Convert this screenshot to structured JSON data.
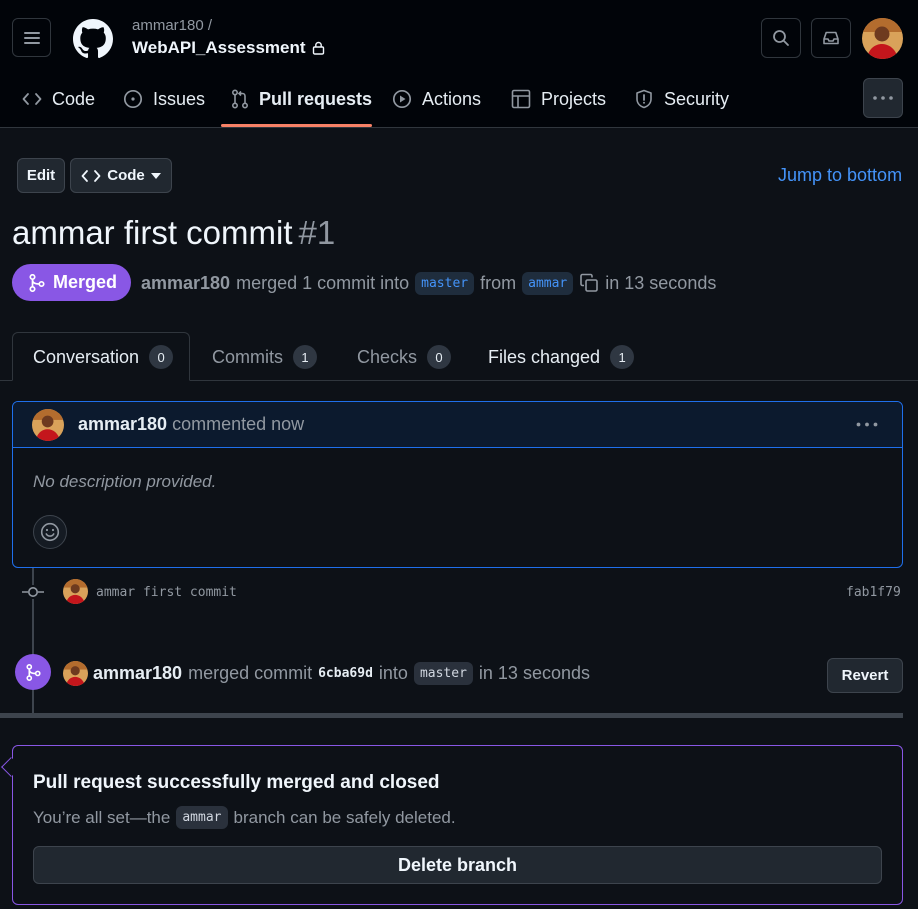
{
  "header": {
    "owner": "ammar180 /",
    "repo": "WebAPI_Assessment"
  },
  "nav": {
    "code": "Code",
    "issues": "Issues",
    "pull_requests": "Pull requests",
    "actions": "Actions",
    "projects": "Projects",
    "security": "Security"
  },
  "toolbar": {
    "edit": "Edit",
    "code": "Code",
    "jump": "Jump to bottom"
  },
  "pr": {
    "title": "ammar first commit",
    "number": "#1",
    "state": "Merged",
    "author": "ammar180",
    "merged_text": "merged 1 commit into",
    "base_branch": "master",
    "from_text": "from",
    "head_branch": "ammar",
    "time_text": "in 13 seconds"
  },
  "tabs": {
    "conversation": "Conversation",
    "conversation_count": "0",
    "commits": "Commits",
    "commits_count": "1",
    "checks": "Checks",
    "checks_count": "0",
    "files": "Files changed",
    "files_count": "1"
  },
  "comment": {
    "author": "ammar180",
    "action": "commented now",
    "body": "No description provided."
  },
  "commit": {
    "message": "ammar first commit",
    "sha": "fab1f79"
  },
  "merge_event": {
    "user": "ammar180",
    "text": "merged commit",
    "sha": "6cba69d",
    "into": "into",
    "branch": "master",
    "time": "in 13 seconds",
    "revert": "Revert"
  },
  "merged_box": {
    "heading": "Pull request successfully merged and closed",
    "before": "You’re all set—the",
    "branch": "ammar",
    "after": "branch can be safely deleted.",
    "delete_label": "Delete branch"
  },
  "colors": {
    "merged": "#8957e5",
    "link": "#4493f8",
    "underline": "#f78166"
  },
  "icons": [
    "hamburger-icon",
    "github-logo-icon",
    "lock-icon",
    "search-icon",
    "inbox-icon",
    "code-icon",
    "issue-icon",
    "pull-request-icon",
    "play-icon",
    "table-icon",
    "shield-icon",
    "kebab-icon",
    "caret-down-icon",
    "merge-icon",
    "copy-icon",
    "smiley-icon",
    "commit-icon"
  ]
}
